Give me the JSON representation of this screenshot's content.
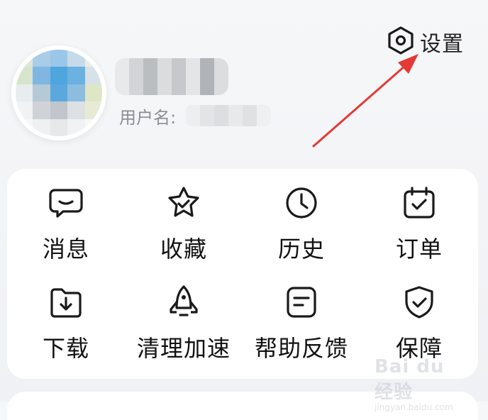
{
  "header": {
    "settings_label": "设置",
    "settings_icon": "hexagon-settings-icon",
    "username_label": "用户名:"
  },
  "menu": [
    {
      "label": "消息",
      "icon": "message-icon"
    },
    {
      "label": "收藏",
      "icon": "star-icon"
    },
    {
      "label": "历史",
      "icon": "clock-icon"
    },
    {
      "label": "订单",
      "icon": "calendar-check-icon"
    },
    {
      "label": "下载",
      "icon": "folder-download-icon"
    },
    {
      "label": "清理加速",
      "icon": "rocket-icon"
    },
    {
      "label": "帮助反馈",
      "icon": "feedback-icon"
    },
    {
      "label": "保障",
      "icon": "shield-check-icon"
    }
  ],
  "watermark": {
    "brand": "Bai du 经验",
    "sub": "jingyan.baidu.com"
  },
  "colors": {
    "arrow": "#e53935",
    "icon_stroke": "#1a1a1a"
  }
}
